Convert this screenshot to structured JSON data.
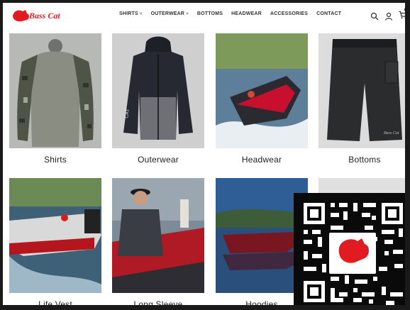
{
  "brand": {
    "logo_text": "Bass Cat",
    "accent": "#e21b23"
  },
  "nav": {
    "items": [
      {
        "label": "SHIRTS",
        "has_dropdown": true
      },
      {
        "label": "OUTERWEAR",
        "has_dropdown": true
      },
      {
        "label": "BOTTOMS",
        "has_dropdown": false
      },
      {
        "label": "HEADWEAR",
        "has_dropdown": false
      },
      {
        "label": "ACCESSORIES",
        "has_dropdown": false
      },
      {
        "label": "CONTACT",
        "has_dropdown": false
      }
    ],
    "chevron": "˅"
  },
  "header_icons": {
    "search": "search-icon",
    "account": "user-icon",
    "cart": "cart-icon",
    "cart_count": "0"
  },
  "categories": [
    {
      "label": "Shirts"
    },
    {
      "label": "Outerwear"
    },
    {
      "label": "Headwear"
    },
    {
      "label": "Bottoms"
    },
    {
      "label": "Life Vest"
    },
    {
      "label": "Long Sleeve"
    },
    {
      "label": "Hoodies"
    }
  ],
  "overlay": {
    "type": "qr-code"
  }
}
